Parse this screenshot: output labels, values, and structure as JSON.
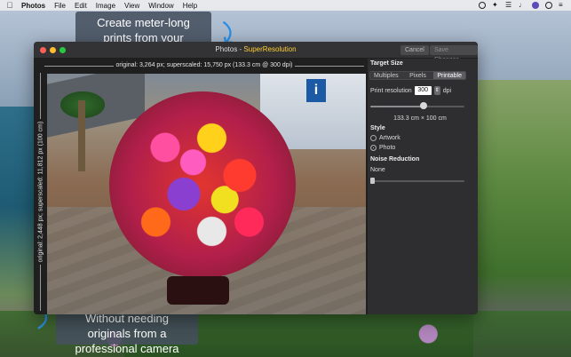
{
  "menubar": {
    "app": "Photos",
    "items": [
      "File",
      "Edit",
      "Image",
      "View",
      "Window",
      "Help"
    ]
  },
  "callouts": {
    "top": "Create meter-long prints from your Photos library",
    "bottom": "Without needing originals from a professional camera"
  },
  "window": {
    "title_app": "Photos",
    "title_sep": " - ",
    "title_ext": "SuperResolution",
    "cancel_label": "Cancel",
    "save_label": "Save Changes"
  },
  "rulers": {
    "top": "original: 3,264 px; superscaled: 15,750 px (133.3 cm @ 300 dpi)",
    "left": "original: 2,448 px; superscaled: 11,812 px (100 cm)"
  },
  "panel": {
    "target_size_title": "Target Size",
    "segments": [
      {
        "label": "Multiples",
        "active": false
      },
      {
        "label": "Pixels",
        "active": false
      },
      {
        "label": "Printable",
        "active": true
      }
    ],
    "print_resolution_label": "Print resolution",
    "print_resolution_value": "300",
    "dpi_label": "dpi",
    "size_slider_level": 0.57,
    "size_text": "133.3 cm × 100 cm",
    "style_title": "Style",
    "style_options": [
      {
        "label": "Artwork",
        "selected": false
      },
      {
        "label": "Photo",
        "selected": true
      }
    ],
    "noise_title": "Noise Reduction",
    "noise_value": "None",
    "noise_slider_level": 0.0
  },
  "colors": {
    "accent_title": "#ffcc33",
    "callout_arrow": "#2b8fe6"
  },
  "icons": [
    "apple-icon",
    "time-machine-icon",
    "bluetooth-icon",
    "wifi-icon",
    "volume-icon",
    "user-avatar-icon",
    "search-icon",
    "menu-icon"
  ]
}
